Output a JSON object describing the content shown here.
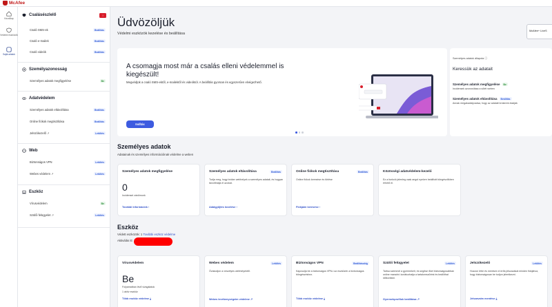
{
  "app": {
    "brand": "McAfee"
  },
  "rail": [
    {
      "label": "Kezdőlap",
      "icon": "home-icon"
    },
    {
      "label": "Védelmi eszközök",
      "icon": "shield-icon"
    },
    {
      "label": "Saját adatok",
      "icon": "user-icon"
    }
  ],
  "sidebar": {
    "fraud": {
      "title": "Csalásészlelő",
      "button_icon": "!",
      "items": [
        {
          "label": "Csaló SMS-ek",
          "badge": "Beállítás"
        },
        {
          "label": "Csaló e-mailek",
          "badge": "Beállítás"
        },
        {
          "label": "Csaló videók",
          "badge": "Beállítás"
        }
      ]
    },
    "identity": {
      "title": "Személyazonosság",
      "items": [
        {
          "label": "Személyes adatok megfigyelése",
          "badge": "Be"
        }
      ]
    },
    "data": {
      "title": "Adatvédelem",
      "items": [
        {
          "label": "Személyes adatok eltávolítása",
          "badge": "Beállítás"
        },
        {
          "label": "Online fiókok megtisztítása",
          "badge": "Beállítás"
        },
        {
          "label": "Jelszókezelő",
          "badge": "Letöltés"
        }
      ]
    },
    "web": {
      "title": "Web",
      "items": [
        {
          "label": "Biztonságos VPN",
          "badge": "Letöltés"
        },
        {
          "label": "Webes védelem",
          "badge": "Letöltés"
        }
      ]
    },
    "device": {
      "title": "Eszköz",
      "items": [
        {
          "label": "Vírusvédelem",
          "badge": "Be"
        },
        {
          "label": "Szülői felügyelet",
          "badge": "Letöltés"
        }
      ]
    }
  },
  "header": {
    "title": "Üdvözöljük",
    "subtitle": "Védelmi eszközök kezelése és beállítása",
    "top_button": "McAfee+ LiveS"
  },
  "hero": {
    "title": "A csomagja most már a csalás elleni védelemmel is kiegészült!",
    "description": "Megvédjük a csaló SMS-ektől, e-mailektől és videóktól. A beállítás gyorsan és egyszerűen elvégezhető.",
    "button": "Indítás"
  },
  "side_panel": {
    "label": "Személyes adatok állapota",
    "title": "Keressük az adatait",
    "row1": "Személyes adatok megfigyelése",
    "row1_badge": "Be",
    "row1_desc": "Incidensek azonosítása a sötét weben",
    "row2": "Személyes adatok eltávolítása",
    "row2_badge": "Beállítás",
    "row2_desc": "Annak megakadályozása, hogy az adatait brókerek eladják"
  },
  "personal": {
    "title": "Személyes adatok",
    "subtitle": "Adatainak és személyes információinak védelme a weben",
    "cards": [
      {
        "title": "Személyes adatok megfigyelése",
        "badge": "",
        "big": "0",
        "body": "Incidensei zárólmunk",
        "link": "További információk"
      },
      {
        "title": "Személyes adatok eltávolítása",
        "badge": "Beállítás",
        "big": "",
        "body": "Tudja meg, hogy bróker webhelyek a személyes adatait, és hogyan távolíthatja el azokat.",
        "link": "Adatgyűjtés kezelése"
      },
      {
        "title": "Online fiókok megtisztítása",
        "badge": "Beállítás",
        "big": "",
        "body": "Online fiókok keresése és törlése",
        "link": "Fiókjaim keresése"
      },
      {
        "title": "Közösségi adatvédelem-kezelő",
        "badge": "",
        "big": "",
        "body": "Ez a funkció jelenleg csak angol nyelvre beállított böngészőkben érhető el.",
        "link": ""
      }
    ]
  },
  "devices": {
    "title": "Eszköz",
    "protected": "Védett eszközök: 1",
    "protected_link": "További eszköz védelme",
    "account": "Aktiválás itt",
    "cards": [
      {
        "title": "Vírusvédelem",
        "badge": "",
        "big": "Be",
        "body": "Folyamatban lévő vizsgálatok",
        "body2": "1 aktív eszköz",
        "link": "Több eszköz védelme"
      },
      {
        "title": "Webes védelem",
        "badge": "Letöltés",
        "big": "",
        "body": "Óvakodjon a veszélyes webhelyektől.",
        "body2": "",
        "link": "Webes tevékenységeim védelme"
      },
      {
        "title": "Biztonságos VPN",
        "badge": "Beállításokig",
        "big": "",
        "body": "Kapcsolja be a biztonságos VPN-t az eszközén a biztonságos böngészéshez.",
        "body2": "",
        "link": "Több eszköz védelme"
      },
      {
        "title": "Szülői felügyelet",
        "badge": "Letöltés",
        "big": "",
        "body": "Tartsa szemmel a gyermekeit, és segítse őket biztonságosabban online maradni: korlátozhatja a tartalomszűrést és beállíthat időkorlátot.",
        "body2": "",
        "link": "Gyermekprofilok beállítása"
      },
      {
        "title": "Jelszókezelő",
        "badge": "Letöltés",
        "big": "",
        "body": "Hozzon létre és mentsen el erős jelszavakat minden fiókjához, hogy biztonságosan be tudjon jelentkezni.",
        "body2": "",
        "link": "Jelszavaim mentése"
      }
    ]
  }
}
